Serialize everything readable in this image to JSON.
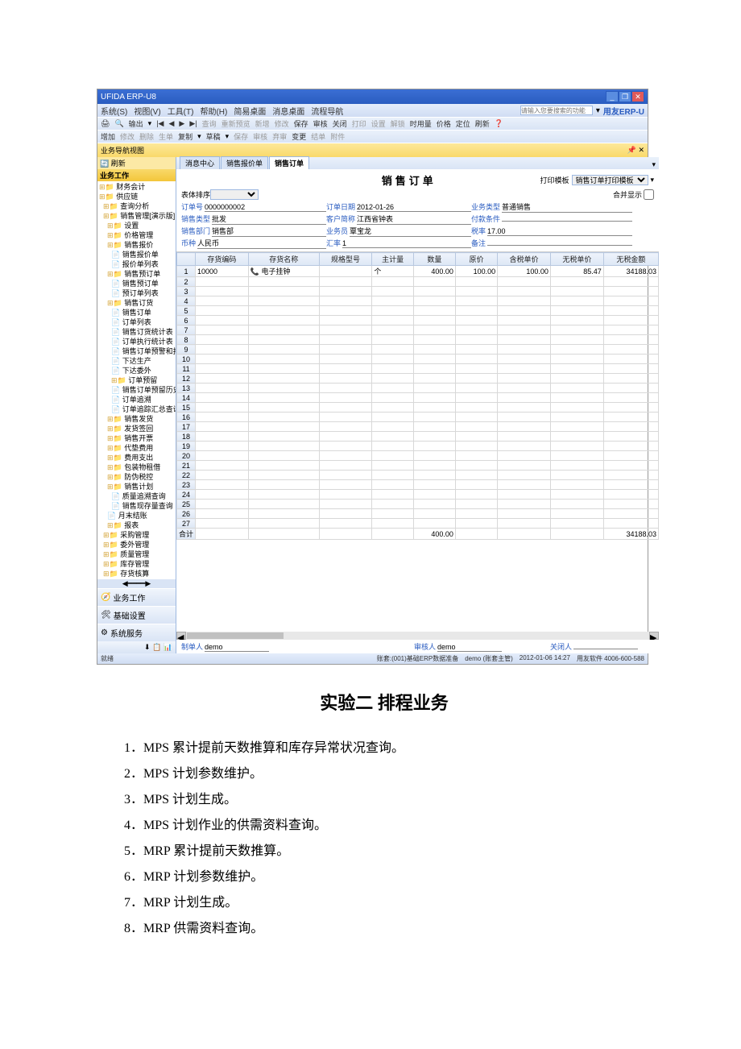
{
  "window": {
    "title": "UFIDA ERP-U8"
  },
  "menubar": {
    "items": [
      "系统(S)",
      "视图(V)",
      "工具(T)",
      "帮助(H)"
    ],
    "quickbtns": [
      "简易桌面",
      "消息桌面",
      "流程导航"
    ],
    "searchHint": "请输入您要搜索的功能",
    "logo": "用友ERP-U"
  },
  "toolbar1": [
    "输出",
    "查询",
    "重新预览",
    "新增",
    "修改",
    "保存",
    "审核",
    "关闭",
    "打印",
    "设置",
    "解锁",
    "时用量",
    "价格",
    "定位",
    "刷新"
  ],
  "toolbar2": [
    "增加",
    "修改",
    "删除",
    "生单",
    "复制",
    "草稿",
    "保存",
    "审核",
    "弃审",
    "变更",
    "结单",
    "附件"
  ],
  "navTitle": "业务导航视图",
  "navTop": "刷新",
  "navSection": "业务工作",
  "tree": [
    {
      "l": 0,
      "t": "财务会计",
      "i": "f"
    },
    {
      "l": 0,
      "t": "供应链",
      "i": "f"
    },
    {
      "l": 1,
      "t": "查询分析",
      "i": "f"
    },
    {
      "l": 1,
      "t": "销售管理[演示版]",
      "i": "f"
    },
    {
      "l": 2,
      "t": "设置",
      "i": "f"
    },
    {
      "l": 2,
      "t": "价格管理",
      "i": "f"
    },
    {
      "l": 2,
      "t": "销售报价",
      "i": "f"
    },
    {
      "l": 3,
      "t": "销售报价单",
      "i": "p"
    },
    {
      "l": 3,
      "t": "报价单列表",
      "i": "p"
    },
    {
      "l": 2,
      "t": "销售预订单",
      "i": "f"
    },
    {
      "l": 3,
      "t": "销售预订单",
      "i": "p"
    },
    {
      "l": 3,
      "t": "预订单列表",
      "i": "p"
    },
    {
      "l": 2,
      "t": "销售订货",
      "i": "f"
    },
    {
      "l": 3,
      "t": "销售订单",
      "i": "p"
    },
    {
      "l": 3,
      "t": "订单列表",
      "i": "p"
    },
    {
      "l": 3,
      "t": "销售订货统计表",
      "i": "p"
    },
    {
      "l": 3,
      "t": "订单执行统计表",
      "i": "p"
    },
    {
      "l": 3,
      "t": "销售订单预警和报",
      "i": "p"
    },
    {
      "l": 3,
      "t": "下达生产",
      "i": "p"
    },
    {
      "l": 3,
      "t": "下达委外",
      "i": "p"
    },
    {
      "l": 3,
      "t": "订单预留",
      "i": "f"
    },
    {
      "l": 3,
      "t": "销售订单预留历史",
      "i": "p"
    },
    {
      "l": 3,
      "t": "订单追溯",
      "i": "p"
    },
    {
      "l": 3,
      "t": "订单追踪汇总查询",
      "i": "p"
    },
    {
      "l": 2,
      "t": "销售发货",
      "i": "f"
    },
    {
      "l": 2,
      "t": "发货签回",
      "i": "f"
    },
    {
      "l": 2,
      "t": "销售开票",
      "i": "f"
    },
    {
      "l": 2,
      "t": "代垫费用",
      "i": "f"
    },
    {
      "l": 2,
      "t": "费用支出",
      "i": "f"
    },
    {
      "l": 2,
      "t": "包装物租借",
      "i": "f"
    },
    {
      "l": 2,
      "t": "防伪税控",
      "i": "f"
    },
    {
      "l": 2,
      "t": "销售计划",
      "i": "f"
    },
    {
      "l": 3,
      "t": "质量追溯查询",
      "i": "p"
    },
    {
      "l": 3,
      "t": "销售现存量查询",
      "i": "p"
    },
    {
      "l": 2,
      "t": "月末结账",
      "i": "p"
    },
    {
      "l": 2,
      "t": "报表",
      "i": "f"
    },
    {
      "l": 1,
      "t": "采购管理",
      "i": "f"
    },
    {
      "l": 1,
      "t": "委外管理",
      "i": "f"
    },
    {
      "l": 1,
      "t": "质量管理",
      "i": "f"
    },
    {
      "l": 1,
      "t": "库存管理",
      "i": "f"
    },
    {
      "l": 1,
      "t": "存货核算",
      "i": "f"
    }
  ],
  "navBottoms": [
    {
      "icon": "🧭",
      "label": "业务工作"
    },
    {
      "icon": "🛠",
      "label": "基础设置"
    },
    {
      "icon": "⚙",
      "label": "系统服务"
    }
  ],
  "navFooter": "⬇ 📋 📊",
  "tabs": [
    "消息中心",
    "销售报价单",
    "销售订单"
  ],
  "form": {
    "title": "销售订单",
    "printTplLabel": "打印模板",
    "printTpl": "销售订单打印模板",
    "mergeLabel": "合并显示",
    "sortLabel": "表体排序",
    "fields": {
      "orderNoLbl": "订单号",
      "orderNo": "0000000002",
      "orderDateLbl": "订单日期",
      "orderDate": "2012-01-26",
      "bizTypeLbl": "业务类型",
      "bizType": "普通销售",
      "saleTypeLbl": "销售类型",
      "saleType": "批发",
      "custLbl": "客户简称",
      "cust": "江西省钟表",
      "payCondLbl": "付款条件",
      "payCond": "",
      "deptLbl": "销售部门",
      "dept": "销售部",
      "salesmanLbl": "业务员",
      "salesman": "覃宝龙",
      "taxRateLbl": "税率",
      "taxRate": "17.00",
      "currencyLbl": "币种",
      "currency": "人民币",
      "exRateLbl": "汇率",
      "exRate": "1",
      "remarkLbl": "备注",
      "remark": ""
    }
  },
  "gridCols": [
    "",
    "存货编码",
    "存货名称",
    "规格型号",
    "主计量",
    "数量",
    "原价",
    "含税单价",
    "无税单价",
    "无税金额"
  ],
  "gridRow": {
    "code": "10000",
    "name": "电子挂钟",
    "unit": "个",
    "qty": "400.00",
    "price": "100.00",
    "taxUnit": "100.00",
    "noTaxUnit": "85.47",
    "noTaxAmt": "34188.03"
  },
  "gridTotal": {
    "label": "合计",
    "qty": "400.00",
    "noTaxAmt": "34188.03"
  },
  "footer": {
    "makerLbl": "制单人",
    "maker": "demo",
    "checkerLbl": "审核人",
    "checker": "demo",
    "closerLbl": "关闭人",
    "closer": ""
  },
  "status": {
    "left": "就绪",
    "acct": "账套:(001)基础ERP数据准备",
    "user": "demo (账套主管)",
    "time": "2012-01-06 14:27",
    "svc": "用友软件 4006-600-588"
  },
  "article": {
    "title": "实验二 排程业务",
    "items": [
      "1．MPS 累计提前天数推算和库存异常状况查询。",
      "2．MPS 计划参数维护。",
      "3．MPS 计划生成。",
      "4．MPS 计划作业的供需资料查询。",
      "5．MRP 累计提前天数推算。",
      "6．MRP 计划参数维护。",
      "7．MRP 计划生成。",
      "8．MRP 供需资料查询。"
    ]
  }
}
